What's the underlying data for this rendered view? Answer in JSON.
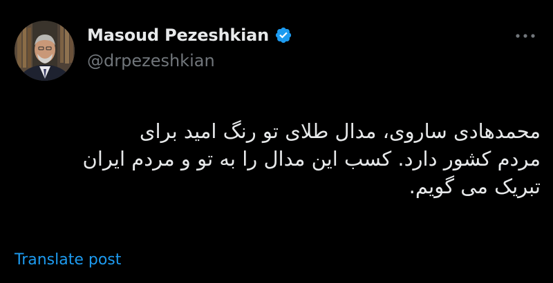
{
  "author": {
    "display_name": "Masoud Pezeshkian",
    "handle": "@drpezeshkian",
    "verified": true
  },
  "post": {
    "lines": [
      "محمدهادی ساروی، مدال طلای تو رنگ امید برای",
      "مردم کشور دارد. کسب این مدال را به تو و مردم ایران",
      "تبریک می گویم."
    ]
  },
  "actions": {
    "translate_label": "Translate post",
    "more_icon": "more-horizontal-icon"
  },
  "colors": {
    "background": "#000000",
    "primary_text": "#e7e9ea",
    "secondary_text": "#71767b",
    "accent": "#1d9bf0"
  }
}
